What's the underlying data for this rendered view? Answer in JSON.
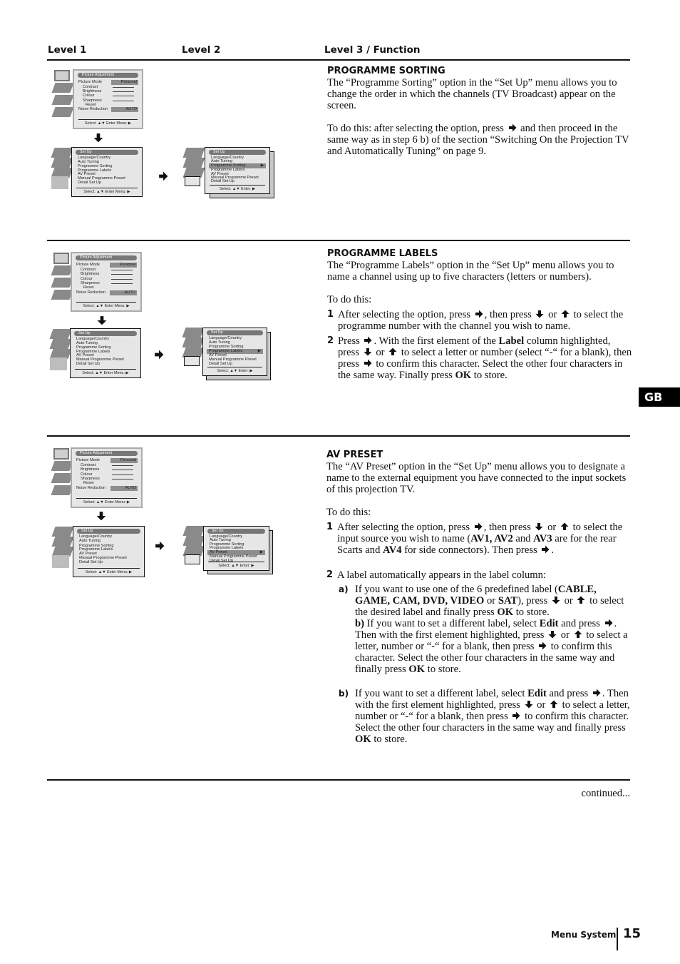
{
  "header": {
    "level1": "Level 1",
    "level2": "Level 2",
    "level3": "Level 3 / Function"
  },
  "menus": {
    "picture": {
      "title": "Picture Adjustment",
      "rows": [
        "Picture Mode",
        "Contrast",
        "Brightness",
        "Colour",
        "Sharpness",
        "Reset",
        "Noise Reduction"
      ],
      "picture_mode_value": "Personal",
      "noise_value": "AUTO",
      "footer": "Select: ▲▼  Enter Menu: ▶"
    },
    "setup": {
      "title": "Set Up",
      "rows": [
        "Language/Country",
        "Auto Tuning",
        "Programme Sorting",
        "Programme Labels",
        "AV Preset",
        "Manual Programme Preset",
        "Detail Set Up"
      ],
      "footer_level1": "Select: ▲▼  Enter Menu: ▶",
      "footer_level2": "Select: ▲▼  Enter: ▶"
    }
  },
  "sections": {
    "sorting": {
      "heading": "PROGRAMME SORTING",
      "intro": "The “Programme Sorting” option in the “Set Up” menu allows you to change the order in which the channels (TV Broadcast) appear on the screen.",
      "todo_a": "To do this: after selecting the option, press",
      "todo_b": "and then proceed in the same way as in step 6 b) of the section “Switching On the Projection TV and Automatically Tuning” on page 9.",
      "highlighted": "Programme Sorting"
    },
    "labels": {
      "heading": "PROGRAMME LABELS",
      "intro": "The “Programme Labels” option in the “Set Up” menu allows you to name a channel using up to five characters (letters or numbers).",
      "todo": "To do this:",
      "step1": {
        "num": "1",
        "a": "After selecting the option, press",
        "b": ", then press",
        "c": "or",
        "d": "to select the programme number with the channel you wish to name."
      },
      "step2": {
        "num": "2",
        "a": "Press",
        "b": ". With the first element of the",
        "bold1": "Label",
        "c": "column highlighted, press",
        "d": "or",
        "e": "to select a letter or number (select “-“ for a blank), then press",
        "f": "to confirm this character. Select the other four characters in the same way. Finally press",
        "bold2": "OK",
        "g": "to store."
      },
      "highlighted": "Programme Labels"
    },
    "av": {
      "heading": "AV PRESET",
      "intro": "The “AV Preset” option in the “Set Up” menu allows you to designate a name to the external equipment you have connected to the input sockets of this projection TV.",
      "todo": "To do this:",
      "step1": {
        "num": "1",
        "a": "After selecting the option, press",
        "b": ", then press",
        "c": "or",
        "d": "to select the input source you wish to name (",
        "av123": "AV1, AV2",
        "and": "and",
        "av3": "AV3",
        "e": "are for the rear Scarts and",
        "av4": "AV4",
        "f": "for side connectors). Then press",
        "g": "."
      },
      "step2": {
        "num": "2",
        "text": "A label automatically appears in the label column:"
      },
      "sub_a": {
        "num": "a)",
        "a": "If you want to use one of the 6 predefined label (",
        "labels": "CABLE, GAME, CAM, DVD, VIDEO",
        "or": "or",
        "sat": "SAT",
        "b": "), press",
        "c": "or",
        "d": "to select the desired label  and finally press",
        "ok": "OK",
        "e": "to store.",
        "inline_b": "b)",
        "f": "If you want to set a different label, select",
        "edit": "Edit",
        "g": "and press",
        "h": ". Then with the first element highlighted, press",
        "i": "or",
        "j": "to select a letter, number or “-“ for a blank, then press",
        "k": "to confirm this character. Select the other four characters in the same way and finally press",
        "ok2": "OK",
        "l": "to store."
      },
      "sub_b": {
        "num": "b)",
        "a": "If you want to set a different label, select",
        "edit": "Edit",
        "b": "and press",
        "c": ". Then with the first element highlighted, press",
        "d": "or",
        "e": "to select a letter, number or “-“ for a blank, then press",
        "f": "to confirm this character. Select the other four characters in the same way and finally press",
        "ok": "OK",
        "g": "to store."
      },
      "highlighted": "AV Preset"
    }
  },
  "side_tab": "GB",
  "continued": "continued...",
  "footer": {
    "section": "Menu System",
    "page": "15"
  }
}
